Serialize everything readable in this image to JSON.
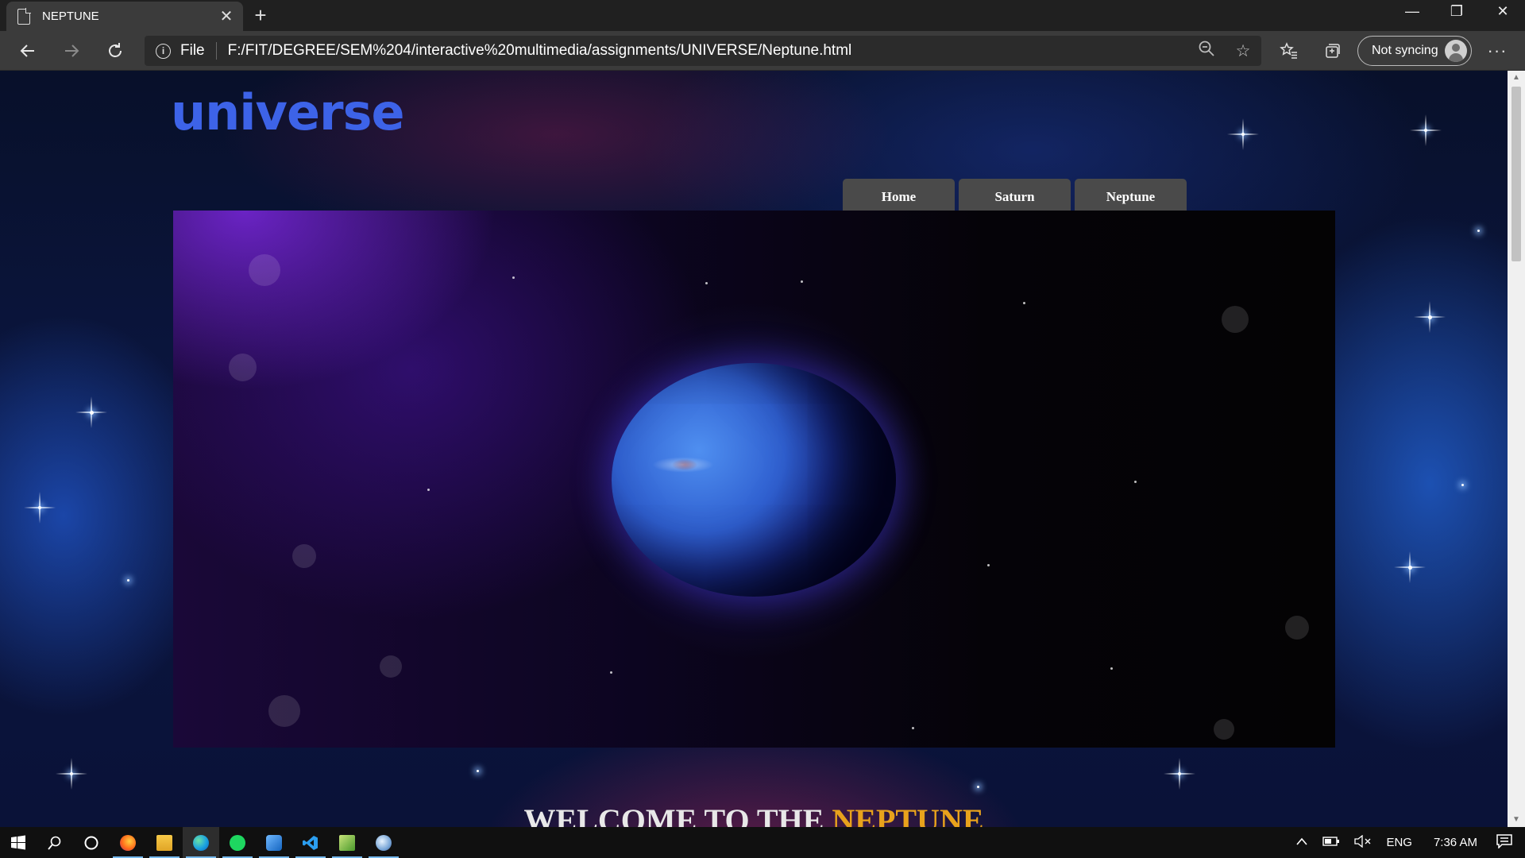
{
  "browser": {
    "tab_title": "NEPTUNE",
    "tab_close": "✕",
    "new_tab": "+",
    "window_controls": {
      "minimize": "—",
      "maximize": "❐",
      "close": "✕"
    },
    "scheme": "File",
    "url": "F:/FIT/DEGREE/SEM%204/interactive%20multimedia/assignments/UNIVERSE/Neptune.html",
    "sync_label": "Not syncing",
    "icons": {
      "back": "back-arrow-icon",
      "forward": "forward-arrow-icon",
      "reload": "reload-icon",
      "info": "info-icon",
      "zoom": "zoom-icon",
      "favorite": "star-icon",
      "favorites": "favorites-icon",
      "collections": "collections-icon",
      "more": "more-icon"
    }
  },
  "page": {
    "logo": "universe",
    "nav": [
      {
        "label": "Home"
      },
      {
        "label": "Saturn"
      },
      {
        "label": "Neptune"
      }
    ],
    "welcome_prefix": "WELCOME TO THE ",
    "welcome_accent": "NEPTUNE",
    "colors": {
      "logo": "#3d63e8",
      "accent": "#e8a21c",
      "nav_bg": "#4a4a4a"
    }
  },
  "taskbar": {
    "apps": [
      "windows-start-icon",
      "search-icon",
      "cortana-icon",
      "firefox-icon",
      "file-explorer-icon",
      "edge-icon",
      "spotify-icon",
      "photos-icon",
      "vscode-icon",
      "notepad-icon",
      "paint-icon"
    ],
    "language": "ENG",
    "time": "7:36 AM"
  }
}
